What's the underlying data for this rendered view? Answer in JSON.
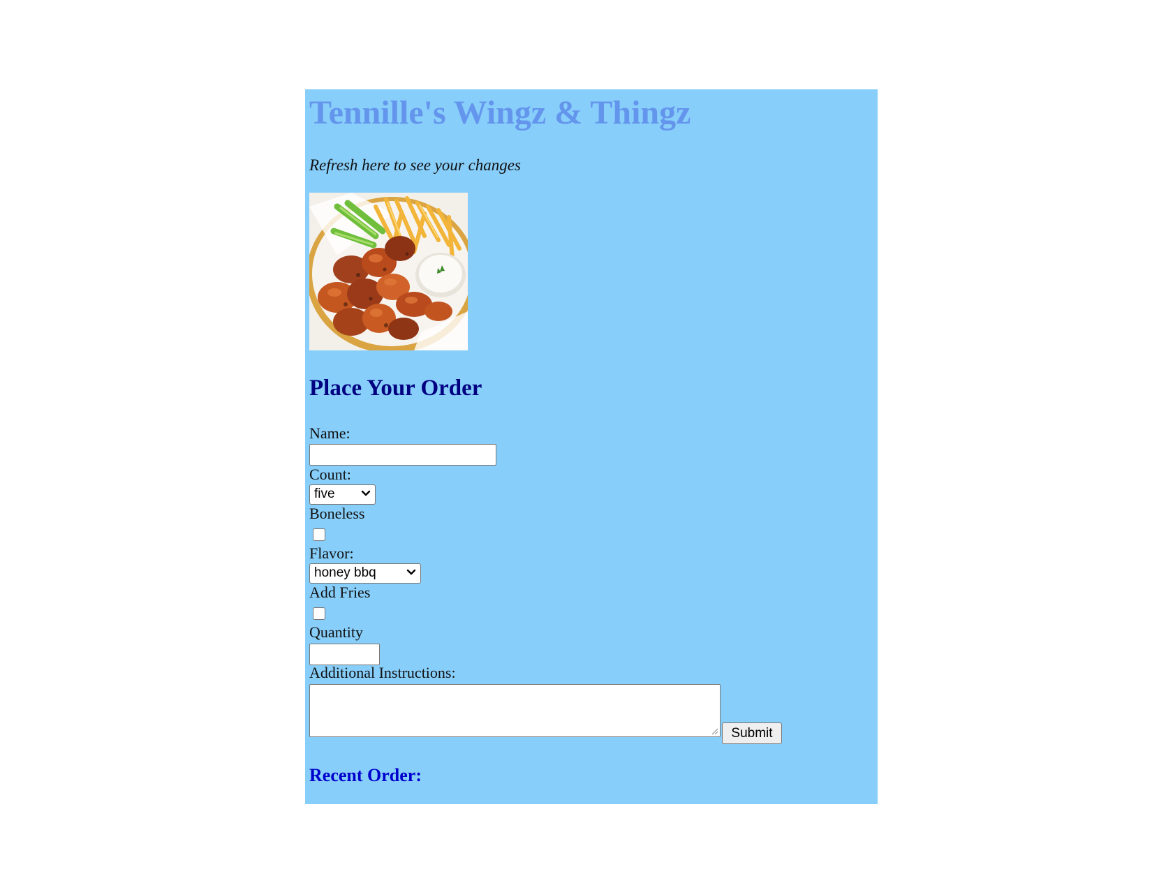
{
  "header": {
    "title": "Tennille's Wingz & Thingz",
    "subtitle": "Refresh here to see your changes"
  },
  "colors": {
    "panel_background": "#87cefa",
    "title": "#6495ed",
    "order_heading": "#000080",
    "recent_heading": "#0000cd"
  },
  "image": {
    "icon": "wings-fries-plate-photo"
  },
  "form": {
    "heading": "Place Your Order",
    "name": {
      "label": "Name:",
      "value": ""
    },
    "count": {
      "label": "Count:",
      "value": "five"
    },
    "boneless": {
      "label": "Boneless",
      "checked": false
    },
    "flavor": {
      "label": "Flavor:",
      "value": "honey bbq"
    },
    "fries": {
      "label": "Add Fries",
      "checked": false
    },
    "quantity": {
      "label": "Quantity",
      "value": ""
    },
    "instructions": {
      "label": "Additional Instructions:",
      "value": ""
    },
    "submit_label": "Submit"
  },
  "recent": {
    "heading": "Recent Order:"
  }
}
